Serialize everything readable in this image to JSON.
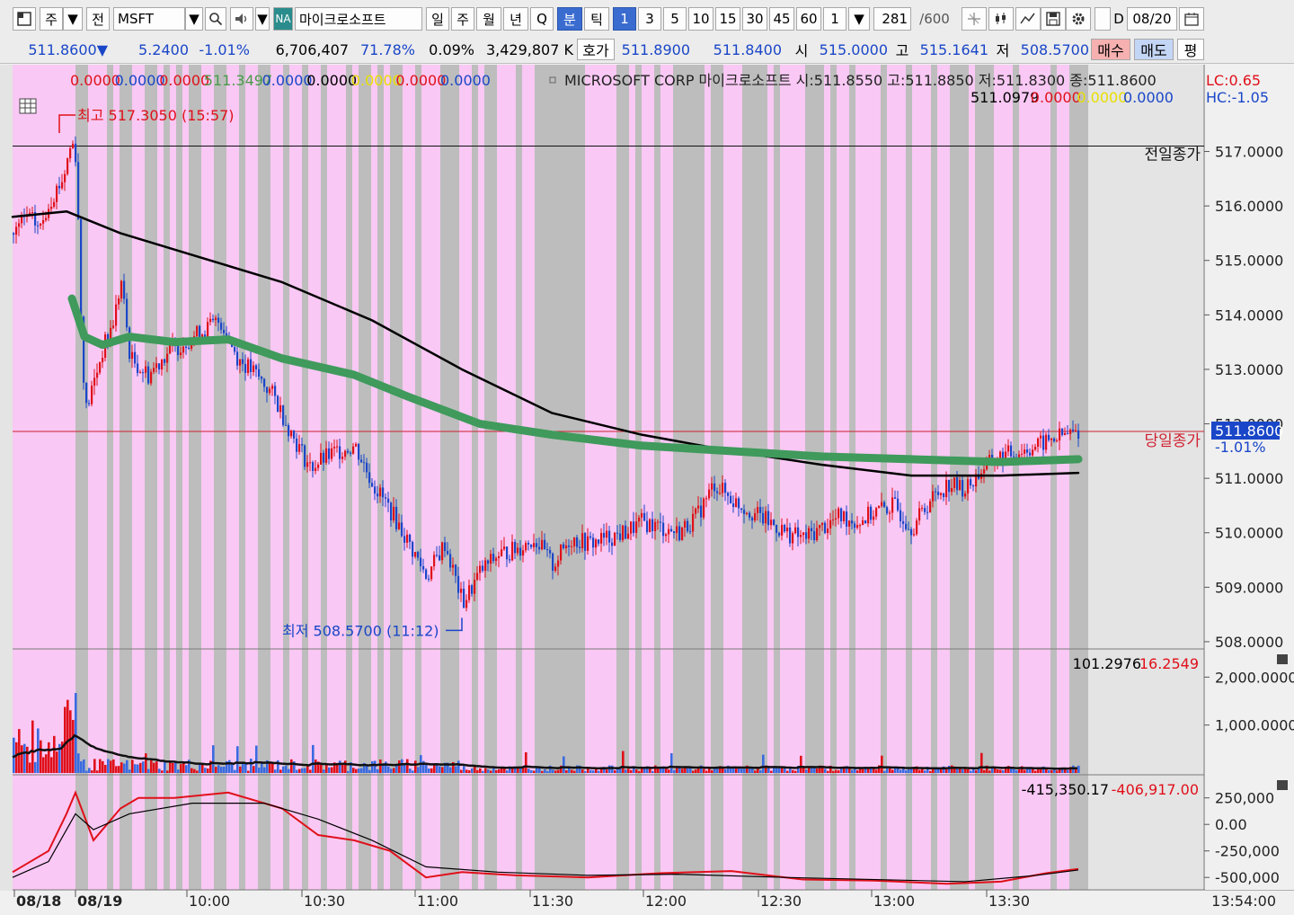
{
  "toolbar": {
    "window_icon": "window-icon",
    "market": "주",
    "market_mode": "전",
    "symbol": "MSFT",
    "na_badge": "NA",
    "symbol_name": "마이크로소프트",
    "periods": [
      "일",
      "주",
      "월",
      "년",
      "Q"
    ],
    "interval_types": [
      "분",
      "틱"
    ],
    "minute_options": [
      "1",
      "3",
      "5",
      "10",
      "15",
      "30",
      "45",
      "60"
    ],
    "multiplier": "1",
    "count_value": "281",
    "count_max": "/600",
    "date_label": "D",
    "date_value": "08/20"
  },
  "quote": {
    "price": "511.8600",
    "arrow": "▼",
    "change": "5.2400",
    "change_pct": "-1.01%",
    "volume": "6,706,407",
    "vol_pct": "71.78%",
    "turnover_pct": "0.09%",
    "amount": "3,429,807 K",
    "bid_label": "호가",
    "ask_price": "511.8900",
    "bid_price": "511.8400",
    "open_label": "시",
    "open": "515.0000",
    "high_label": "고",
    "high": "515.1641",
    "low_label": "저",
    "low": "508.5700",
    "buy_button": "매수",
    "sell_button": "매도",
    "avg_button": "평"
  },
  "chart_data": [
    {
      "type": "line",
      "panel": "price",
      "header_values": [
        {
          "text": "0.0000",
          "color": "#e0101a"
        },
        {
          "text": "0.0000",
          "color": "#1a46c8"
        },
        {
          "text": "0.0000",
          "color": "#e0101a"
        },
        {
          "text": "511.3497",
          "color": "#4a9a4a"
        },
        {
          "text": "0.0000",
          "color": "#1a46c8"
        },
        {
          "text": "0.0000",
          "color": "#000000"
        },
        {
          "text": "0.0000",
          "color": "#e8e000"
        },
        {
          "text": "0.0000",
          "color": "#e0101a"
        },
        {
          "text": "0.0000",
          "color": "#1a46c8"
        }
      ],
      "info_line": "MICROSOFT CORP  마이크로소프트 시:511.8550 고:511.8850 저:511.8300 종:511.8600",
      "sub_values": [
        {
          "text": "511.0979",
          "color": "#000000"
        },
        {
          "text": "0.0000",
          "color": "#e0101a"
        },
        {
          "text": "0.0000",
          "color": "#e8e000"
        },
        {
          "text": "0.0000",
          "color": "#1a46c8"
        }
      ],
      "lc_label": "LC:0.65",
      "hc_label": "HC:-1.05",
      "y_ticks": [
        "517.0000",
        "516.0000",
        "515.0000",
        "514.0000",
        "513.0000",
        "512.0000",
        "511.0000",
        "510.0000",
        "509.0000",
        "508.0000"
      ],
      "ylim": [
        507.9,
        517.9
      ],
      "prev_close": 517.1,
      "prev_close_label": "전일종가",
      "today_close": 511.86,
      "today_close_label": "당일종가",
      "last_price_label": "511.8600",
      "last_change_label": "-1.01%",
      "high_marker": {
        "label": "최고 517.3050 (15:57)",
        "value": 517.305
      },
      "low_marker": {
        "label": "최저 508.5700 (11:12)",
        "value": 508.57
      },
      "series": [
        {
          "name": "",
          "color": "#000000",
          "values": [
            [
              0,
              515.8
            ],
            [
              60,
              515.9
            ],
            [
              120,
              515.5
            ],
            [
              200,
              515.1
            ],
            [
              300,
              514.6
            ],
            [
              400,
              513.9
            ],
            [
              500,
              513.0
            ],
            [
              600,
              512.2
            ],
            [
              700,
              511.8
            ],
            [
              800,
              511.5
            ],
            [
              900,
              511.25
            ],
            [
              1000,
              511.05
            ],
            [
              1100,
              511.05
            ],
            [
              1186,
              511.1
            ]
          ]
        },
        {
          "name": "",
          "color": "#3f9a5c",
          "values": [
            [
              66,
              514.3
            ],
            [
              80,
              513.6
            ],
            [
              100,
              513.45
            ],
            [
              130,
              513.6
            ],
            [
              180,
              513.5
            ],
            [
              240,
              513.55
            ],
            [
              300,
              513.2
            ],
            [
              380,
              512.9
            ],
            [
              440,
              512.5
            ],
            [
              520,
              512.0
            ],
            [
              600,
              511.8
            ],
            [
              700,
              511.6
            ],
            [
              800,
              511.5
            ],
            [
              900,
              511.4
            ],
            [
              1000,
              511.35
            ],
            [
              1100,
              511.3
            ],
            [
              1186,
              511.35
            ]
          ]
        }
      ],
      "price_path": [
        [
          0,
          515.5
        ],
        [
          15,
          515.8
        ],
        [
          30,
          515.6
        ],
        [
          40,
          516.1
        ],
        [
          55,
          516.5
        ],
        [
          65,
          517.2
        ],
        [
          70,
          516.9
        ],
        [
          75,
          514.0
        ],
        [
          80,
          512.2
        ],
        [
          90,
          512.8
        ],
        [
          100,
          513.4
        ],
        [
          110,
          513.8
        ],
        [
          120,
          514.6
        ],
        [
          130,
          513.2
        ],
        [
          150,
          512.9
        ],
        [
          170,
          513.3
        ],
        [
          190,
          513.5
        ],
        [
          210,
          513.7
        ],
        [
          230,
          513.9
        ],
        [
          250,
          513.2
        ],
        [
          270,
          512.9
        ],
        [
          290,
          512.5
        ],
        [
          310,
          511.8
        ],
        [
          330,
          511.2
        ],
        [
          360,
          511.5
        ],
        [
          380,
          511.6
        ],
        [
          400,
          510.9
        ],
        [
          420,
          510.4
        ],
        [
          440,
          509.8
        ],
        [
          460,
          509.2
        ],
        [
          480,
          509.8
        ],
        [
          500,
          508.7
        ],
        [
          520,
          509.3
        ],
        [
          540,
          509.6
        ],
        [
          560,
          509.7
        ],
        [
          580,
          509.9
        ],
        [
          600,
          509.4
        ],
        [
          620,
          509.9
        ],
        [
          640,
          509.8
        ],
        [
          660,
          509.9
        ],
        [
          680,
          510.0
        ],
        [
          700,
          510.2
        ],
        [
          720,
          510.1
        ],
        [
          740,
          510.0
        ],
        [
          760,
          510.3
        ],
        [
          780,
          510.9
        ],
        [
          800,
          510.6
        ],
        [
          820,
          510.4
        ],
        [
          840,
          510.2
        ],
        [
          860,
          510.0
        ],
        [
          880,
          509.9
        ],
        [
          900,
          510.1
        ],
        [
          920,
          510.3
        ],
        [
          940,
          510.2
        ],
        [
          960,
          510.4
        ],
        [
          980,
          510.5
        ],
        [
          1000,
          510.1
        ],
        [
          1020,
          510.6
        ],
        [
          1040,
          510.9
        ],
        [
          1060,
          510.8
        ],
        [
          1080,
          511.2
        ],
        [
          1100,
          511.4
        ],
        [
          1120,
          511.5
        ],
        [
          1140,
          511.6
        ],
        [
          1160,
          511.75
        ],
        [
          1186,
          511.86
        ]
      ]
    },
    {
      "type": "bar",
      "panel": "volume",
      "value_labels": [
        {
          "text": "101.2976",
          "color": "#000000"
        },
        {
          "text": "16.2549",
          "color": "#e0101a"
        }
      ],
      "y_ticks": [
        "2,000.0000",
        "1,000.0000"
      ],
      "ylim": [
        0,
        2400
      ]
    },
    {
      "type": "line",
      "panel": "indicator",
      "value_labels": [
        {
          "text": "-415,350.17",
          "color": "#000000"
        },
        {
          "text": "-406,917.00",
          "color": "#e0101a"
        }
      ],
      "y_ticks": [
        "250,000",
        "0.00",
        "-250,000",
        "-500,000"
      ],
      "ylim": [
        -600000,
        400000
      ],
      "series": [
        {
          "name": "",
          "color": "#e0101a",
          "values": [
            [
              0,
              -450000
            ],
            [
              40,
              -250000
            ],
            [
              60,
              100000
            ],
            [
              70,
              300000
            ],
            [
              90,
              -150000
            ],
            [
              120,
              150000
            ],
            [
              140,
              250000
            ],
            [
              180,
              250000
            ],
            [
              240,
              300000
            ],
            [
              300,
              150000
            ],
            [
              340,
              -100000
            ],
            [
              380,
              -150000
            ],
            [
              420,
              -250000
            ],
            [
              460,
              -500000
            ],
            [
              500,
              -450000
            ],
            [
              560,
              -480000
            ],
            [
              640,
              -500000
            ],
            [
              720,
              -460000
            ],
            [
              800,
              -440000
            ],
            [
              880,
              -520000
            ],
            [
              960,
              -530000
            ],
            [
              1040,
              -560000
            ],
            [
              1100,
              -540000
            ],
            [
              1150,
              -460000
            ],
            [
              1186,
              -420000
            ]
          ]
        },
        {
          "name": "",
          "color": "#000000",
          "values": [
            [
              0,
              -500000
            ],
            [
              40,
              -350000
            ],
            [
              70,
              100000
            ],
            [
              90,
              -50000
            ],
            [
              130,
              100000
            ],
            [
              200,
              200000
            ],
            [
              280,
              200000
            ],
            [
              340,
              50000
            ],
            [
              400,
              -150000
            ],
            [
              460,
              -400000
            ],
            [
              540,
              -450000
            ],
            [
              640,
              -480000
            ],
            [
              740,
              -470000
            ],
            [
              860,
              -500000
            ],
            [
              960,
              -520000
            ],
            [
              1060,
              -540000
            ],
            [
              1140,
              -480000
            ],
            [
              1186,
              -430000
            ]
          ]
        }
      ]
    }
  ],
  "time_axis": {
    "labels": [
      "08/18",
      "08/19",
      "10:00",
      "10:30",
      "11:00",
      "11:30",
      "12:00",
      "12:30",
      "13:00",
      "13:30"
    ],
    "current_time": "13:54:00"
  }
}
